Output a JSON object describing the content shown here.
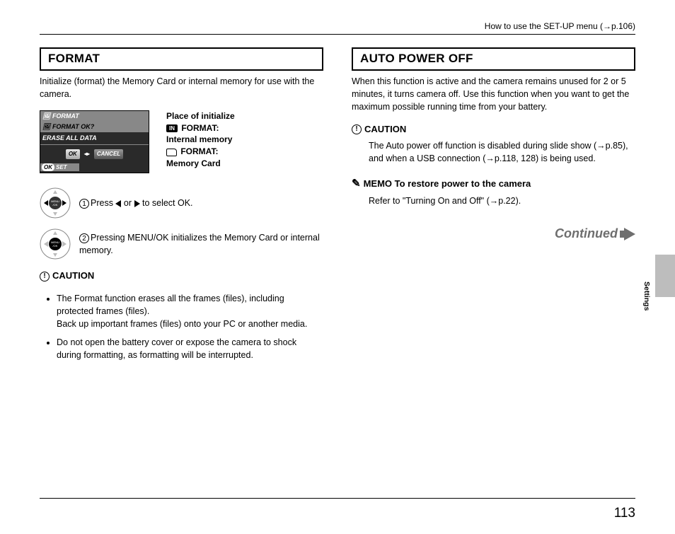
{
  "header": {
    "text": "How to use the SET-UP menu (→p.106)"
  },
  "left": {
    "title": "FORMAT",
    "intro": "Initialize (format) the Memory Card or internal memory for use with the camera.",
    "lcd": {
      "title": "FORMAT",
      "question": "FORMAT OK?",
      "erase": "ERASE ALL DATA",
      "ok": "OK",
      "cancel": "CANCEL",
      "set": "SET"
    },
    "lcd_side": {
      "heading": "Place of initialize",
      "in_line1": "FORMAT:",
      "in_line2": "Internal memory",
      "card_line1": "FORMAT:",
      "card_line2": "Memory Card"
    },
    "step1_a": "Press ",
    "step1_b": " or ",
    "step1_c": " to select OK.",
    "step2": "Pressing MENU/OK initializes the Memory Card or internal memory.",
    "caution_head": "CAUTION",
    "caution1": "The Format function erases all the frames (files), including protected frames (files).\nBack up important frames (files) onto your PC or another media.",
    "caution2": "Do not open the battery cover or expose the camera to shock during formatting, as formatting will be interrupted."
  },
  "right": {
    "title": "AUTO POWER OFF",
    "intro": "When this function is active and the camera remains unused for 2 or 5 minutes, it turns camera off. Use this function when you want to get the maximum possible running time from your battery.",
    "caution_head": "CAUTION",
    "caution_body": "The Auto power off function is disabled during slide show (→p.85), and when a USB connection (→p.118, 128) is being used.",
    "memo_head": "MEMO To restore power to the camera",
    "memo_body": "Refer to \"Turning On and Off\" (→p.22).",
    "continued": "Continued"
  },
  "side_label": "Settings",
  "page_number": "113"
}
